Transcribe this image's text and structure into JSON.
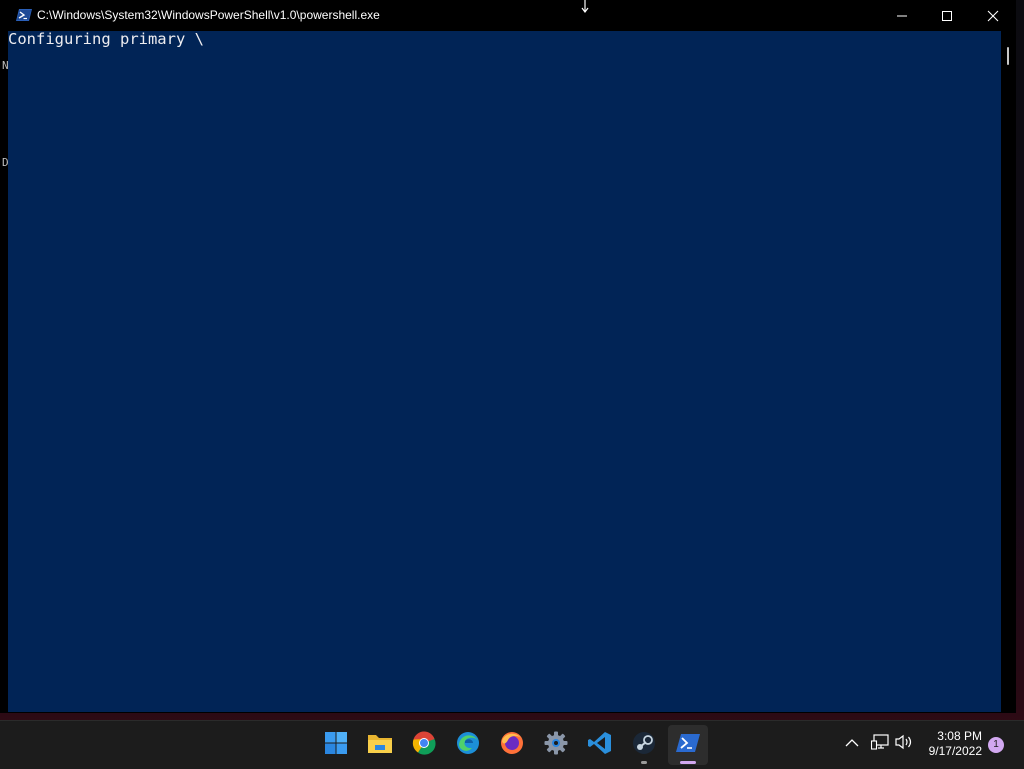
{
  "window": {
    "title": "C:\\Windows\\System32\\WindowsPowerShell\\v1.0\\powershell.exe",
    "console_output": "Configuring primary \\",
    "left_strip_chars": [
      "N",
      "D"
    ]
  },
  "window_controls": {
    "minimize": "minimize-icon",
    "maximize": "maximize-icon",
    "close": "close-icon"
  },
  "taskbar": {
    "apps": [
      {
        "name": "start",
        "icon": "windows-logo-icon",
        "active": false
      },
      {
        "name": "file-explorer",
        "icon": "folder-icon",
        "active": false
      },
      {
        "name": "chrome",
        "icon": "chrome-icon",
        "active": false
      },
      {
        "name": "edge",
        "icon": "edge-icon",
        "active": false
      },
      {
        "name": "firefox",
        "icon": "firefox-icon",
        "active": false
      },
      {
        "name": "settings",
        "icon": "gear-icon",
        "active": false
      },
      {
        "name": "vscode",
        "icon": "vscode-icon",
        "active": false
      },
      {
        "name": "steam",
        "icon": "steam-icon",
        "active": false,
        "running": true
      },
      {
        "name": "powershell",
        "icon": "powershell-icon",
        "active": true
      }
    ],
    "tray": {
      "chevron": "chevron-up-icon",
      "network": "network-icon",
      "volume": "volume-icon"
    },
    "clock": {
      "time": "3:08 PM",
      "date": "9/17/2022"
    },
    "notification_count": "1"
  },
  "colors": {
    "console_bg": "#012456",
    "console_fg": "#eeedf0",
    "taskbar_bg": "#1c1c1c",
    "active_indicator": "#d2a8f0"
  }
}
